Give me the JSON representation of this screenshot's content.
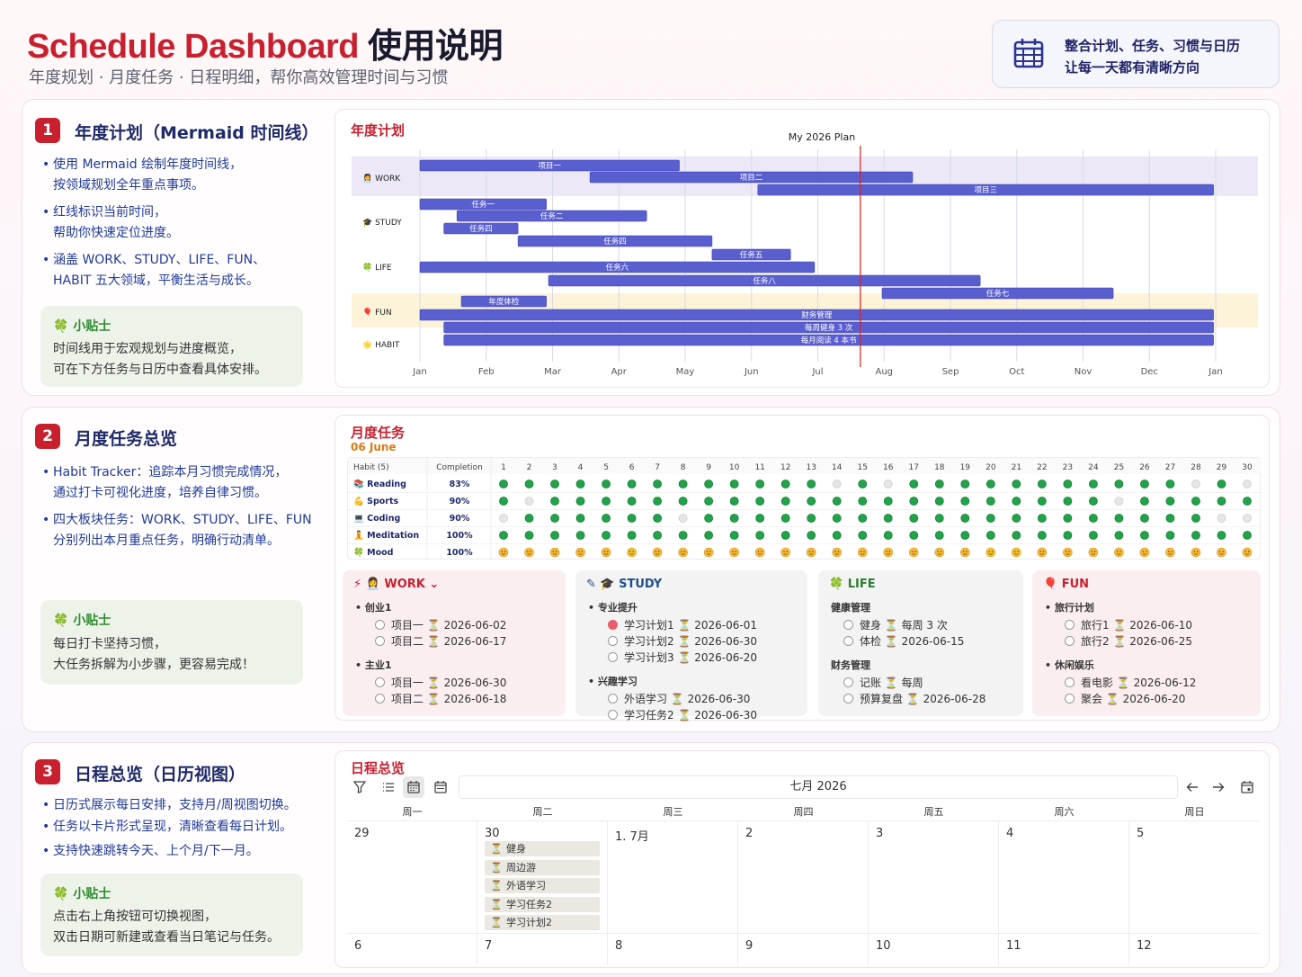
{
  "header": {
    "title_en": "Schedule Dashboard",
    "title_cn": "使用说明",
    "subtitle": "年度规划 · 月度任务 · 日程明细，帮你高效管理时间与习惯",
    "card_line1": "整合计划、任务、习惯与日历",
    "card_line2": "让每一天都有清晰方向",
    "card_icon": "calendar-icon"
  },
  "s1": {
    "num": "1",
    "title": "年度计划（Mermaid 时间线）",
    "bullets": [
      [
        "使用 Mermaid 绘制年度时间线，",
        "按领域规划全年重点事项。"
      ],
      [
        "红线标识当前时间，",
        "帮助你快速定位进度。"
      ],
      [
        "涵盖 WORK、STUDY、LIFE、FUN、",
        "HABIT 五大领域，平衡生活与成长。"
      ]
    ],
    "tip_title": "小贴士",
    "tip": [
      "时间线用于宏观规划与进度概览，",
      "可在下方任务与日历中查看具体安排。"
    ],
    "panel_title": "年度计划"
  },
  "chart_data": {
    "type": "gantt",
    "title": "My 2026 Plan",
    "months": [
      "Jan",
      "Feb",
      "Mar",
      "Apr",
      "May",
      "Jun",
      "Jul",
      "Aug",
      "Sep",
      "Oct",
      "Nov",
      "Dec",
      "Jan"
    ],
    "current_marker": "2026-07-22",
    "sections": [
      {
        "name": "WORK",
        "icon": "👩‍💼",
        "tasks": [
          {
            "name": "项目一",
            "start": "2026-01-01",
            "end": "2026-04-30"
          },
          {
            "name": "项目二",
            "start": "2026-03-20",
            "end": "2026-08-15"
          },
          {
            "name": "项目三",
            "start": "2026-06-05",
            "end": "2026-12-31"
          }
        ]
      },
      {
        "name": "STUDY",
        "icon": "🎓",
        "tasks": [
          {
            "name": "任务一",
            "start": "2026-01-01",
            "end": "2026-02-28"
          },
          {
            "name": "任务二",
            "start": "2026-01-18",
            "end": "2026-04-15"
          },
          {
            "name": "任务四",
            "start": "2026-01-12",
            "end": "2026-02-15"
          },
          {
            "name": "任务四",
            "start": "2026-02-15",
            "end": "2026-05-15"
          },
          {
            "name": "任务五",
            "start": "2026-05-15",
            "end": "2026-06-20"
          }
        ]
      },
      {
        "name": "LIFE",
        "icon": "🍀",
        "tasks": [
          {
            "name": "任务六",
            "start": "2026-01-01",
            "end": "2026-07-01"
          },
          {
            "name": "任务七",
            "start": "2026-08-01",
            "end": "2026-11-15"
          },
          {
            "name": "任务八",
            "start": "2026-03-01",
            "end": "2026-09-15"
          }
        ]
      },
      {
        "name": "FUN",
        "icon": "🎈",
        "tasks": [
          {
            "name": "年度体检",
            "start": "2026-01-20",
            "end": "2026-02-28"
          }
        ]
      },
      {
        "name": "HABIT",
        "icon": "🌟",
        "tasks": [
          {
            "name": "财务管理",
            "start": "2026-01-01",
            "end": "2026-12-31"
          },
          {
            "name": "每周健身 3 次",
            "start": "2026-01-12",
            "end": "2026-12-31"
          },
          {
            "name": "每月阅读 4 本书",
            "start": "2026-01-12",
            "end": "2026-12-31"
          }
        ]
      }
    ]
  },
  "s2": {
    "num": "2",
    "title": "月度任务总览",
    "bullets": [
      [
        "Habit Tracker：追踪本月习惯完成情况，",
        "通过打卡可视化进度，培养自律习惯。"
      ],
      [
        "四大板块任务：WORK、STUDY、LIFE、FUN",
        "分别列出本月重点任务，明确行动清单。"
      ]
    ],
    "tip_title": "小贴士",
    "tip": [
      "每日打卡坚持习惯，",
      "大任务拆解为小步骤，更容易完成！"
    ],
    "panel_title": "月度任务",
    "panel_sub": "06 June"
  },
  "habits": {
    "header_habit": "Habit (5)",
    "header_completion": "Completion",
    "days": [
      "1",
      "2",
      "3",
      "4",
      "5",
      "6",
      "7",
      "8",
      "9",
      "10",
      "11",
      "12",
      "13",
      "14",
      "15",
      "16",
      "17",
      "18",
      "19",
      "20",
      "21",
      "22",
      "23",
      "24",
      "25",
      "26",
      "27",
      "28",
      "29",
      "30"
    ],
    "rows": [
      {
        "icon": "📚",
        "name": "Reading",
        "completion": "83%",
        "marks": "gggggggggggggwgwgggggggggggwgw"
      },
      {
        "icon": "💪",
        "name": "Sports",
        "completion": "90%",
        "marks": "gwggggggggggggggggggggggwggggg"
      },
      {
        "icon": "💻",
        "name": "Coding",
        "completion": "90%",
        "marks": "wggggggwggggggggggggggggggggww"
      },
      {
        "icon": "🧘",
        "name": "Meditation",
        "completion": "100%",
        "marks": "gggggggggggggggggggggggggggggg"
      },
      {
        "icon": "🍀",
        "name": "Mood",
        "completion": "100%",
        "marks": "mmmmmsmmmmmmmmmmmmmssmmmmmmmmm"
      }
    ]
  },
  "cards": {
    "work": {
      "title": "👩‍💼 WORK",
      "bg": "#fbeef0",
      "color": "#c8202f",
      "groups": [
        {
          "name": "创业1",
          "items": [
            {
              "t": "项目一",
              "d": "2026-06-02",
              "done": false
            },
            {
              "t": "项目二",
              "d": "2026-06-17",
              "done": false
            }
          ]
        },
        {
          "name": "主业1",
          "items": [
            {
              "t": "项目一",
              "d": "2026-06-30",
              "done": false
            },
            {
              "t": "项目二",
              "d": "2026-06-18",
              "done": false
            }
          ]
        }
      ]
    },
    "study": {
      "title": "🎓 STUDY",
      "bg": "#f3f3f3",
      "color": "#1f4f8a",
      "groups": [
        {
          "name": "专业提升",
          "items": [
            {
              "t": "学习计划1",
              "d": "2026-06-01",
              "done": true
            },
            {
              "t": "学习计划2",
              "d": "2026-06-30",
              "done": false
            },
            {
              "t": "学习计划3",
              "d": "2026-06-20",
              "done": false
            }
          ]
        },
        {
          "name": "兴趣学习",
          "items": [
            {
              "t": "外语学习",
              "d": "2026-06-30",
              "done": false
            },
            {
              "t": "学习任务2",
              "d": "2026-06-30",
              "done": false
            }
          ]
        }
      ]
    },
    "life": {
      "title": "🍀 LIFE",
      "bg": "#f3f3f3",
      "color": "#2e7d32",
      "groups": [
        {
          "name": "健康管理",
          "items": [
            {
              "t": "健身",
              "d": "每周 3 次",
              "done": false
            },
            {
              "t": "体检",
              "d": "2026-06-15",
              "done": false
            }
          ]
        },
        {
          "name": "财务管理",
          "items": [
            {
              "t": "记账",
              "d": "每周",
              "done": false
            },
            {
              "t": "预算复盘",
              "d": "2026-06-28",
              "done": false
            }
          ]
        }
      ]
    },
    "fun": {
      "title": "🎈 FUN",
      "bg": "#fbeef0",
      "color": "#c8202f",
      "groups": [
        {
          "name": "旅行计划",
          "items": [
            {
              "t": "旅行1",
              "d": "2026-06-10",
              "done": false
            },
            {
              "t": "旅行2",
              "d": "2026-06-25",
              "done": false
            }
          ]
        },
        {
          "name": "休闲娱乐",
          "items": [
            {
              "t": "看电影",
              "d": "2026-06-12",
              "done": false
            },
            {
              "t": "聚会",
              "d": "2026-06-20",
              "done": false
            }
          ]
        }
      ]
    }
  },
  "s3": {
    "num": "3",
    "title": "日程总览（日历视图）",
    "bullets": [
      [
        "日历式展示每日安排，支持月/周视图切换。"
      ],
      [
        "任务以卡片形式呈现，清晰查看每日计划。"
      ],
      [
        "支持快速跳转今天、上个月/下一月。"
      ]
    ],
    "tip_title": "小贴士",
    "tip": [
      "点击右上角按钮可切换视图，",
      "双击日期可新建或查看当日笔记与任务。"
    ],
    "panel_title": "日程总览"
  },
  "calendar": {
    "month_label": "七月 2026",
    "weekdays": [
      "周一",
      "周二",
      "周三",
      "周四",
      "周五",
      "周六",
      "周日"
    ],
    "week1": [
      "29",
      "30",
      "1. 7月",
      "2",
      "3",
      "4",
      "5"
    ],
    "week2": [
      "6",
      "7",
      "8",
      "9",
      "10",
      "11",
      "12"
    ],
    "events_30": [
      "健身",
      "周边游",
      "外语学习",
      "学习任务2",
      "学习计划2"
    ]
  }
}
